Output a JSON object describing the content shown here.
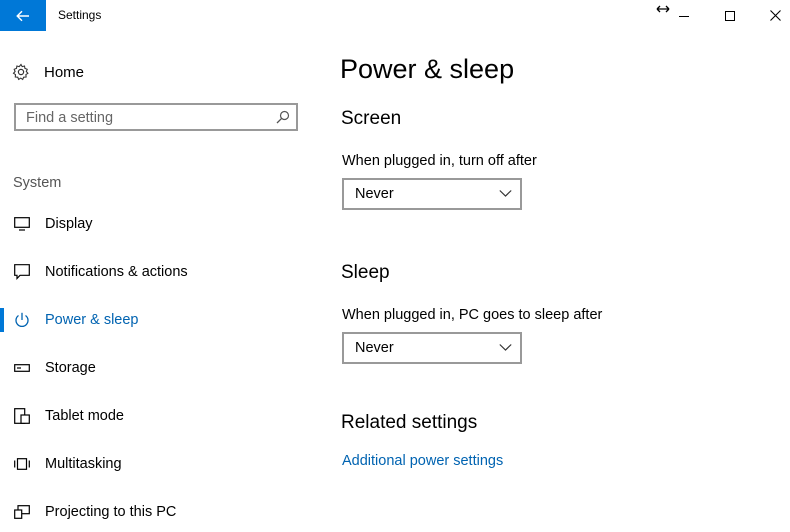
{
  "window": {
    "title": "Settings",
    "back_icon": "arrow-left-icon",
    "controls": [
      "minimize-icon",
      "maximize-icon",
      "close-icon"
    ],
    "accent": "#0078d7"
  },
  "sidebar": {
    "home_label": "Home",
    "search": {
      "placeholder": "Find a setting"
    },
    "group_label": "System",
    "items": [
      {
        "label": "Display",
        "icon": "monitor-icon",
        "active": false
      },
      {
        "label": "Notifications & actions",
        "icon": "notification-icon",
        "active": false
      },
      {
        "label": "Power & sleep",
        "icon": "power-icon",
        "active": true
      },
      {
        "label": "Storage",
        "icon": "storage-icon",
        "active": false
      },
      {
        "label": "Tablet mode",
        "icon": "tablet-icon",
        "active": false
      },
      {
        "label": "Multitasking",
        "icon": "multitasking-icon",
        "active": false
      },
      {
        "label": "Projecting to this PC",
        "icon": "projecting-icon",
        "active": false
      }
    ]
  },
  "main": {
    "title": "Power & sleep",
    "screen": {
      "heading": "Screen",
      "label": "When plugged in, turn off after",
      "value": "Never"
    },
    "sleep": {
      "heading": "Sleep",
      "label": "When plugged in, PC goes to sleep after",
      "value": "Never"
    },
    "related": {
      "heading": "Related settings",
      "link": "Additional power settings"
    }
  },
  "colors": {
    "accent": "#0078d7",
    "link": "#0063b1",
    "border": "#999999"
  }
}
